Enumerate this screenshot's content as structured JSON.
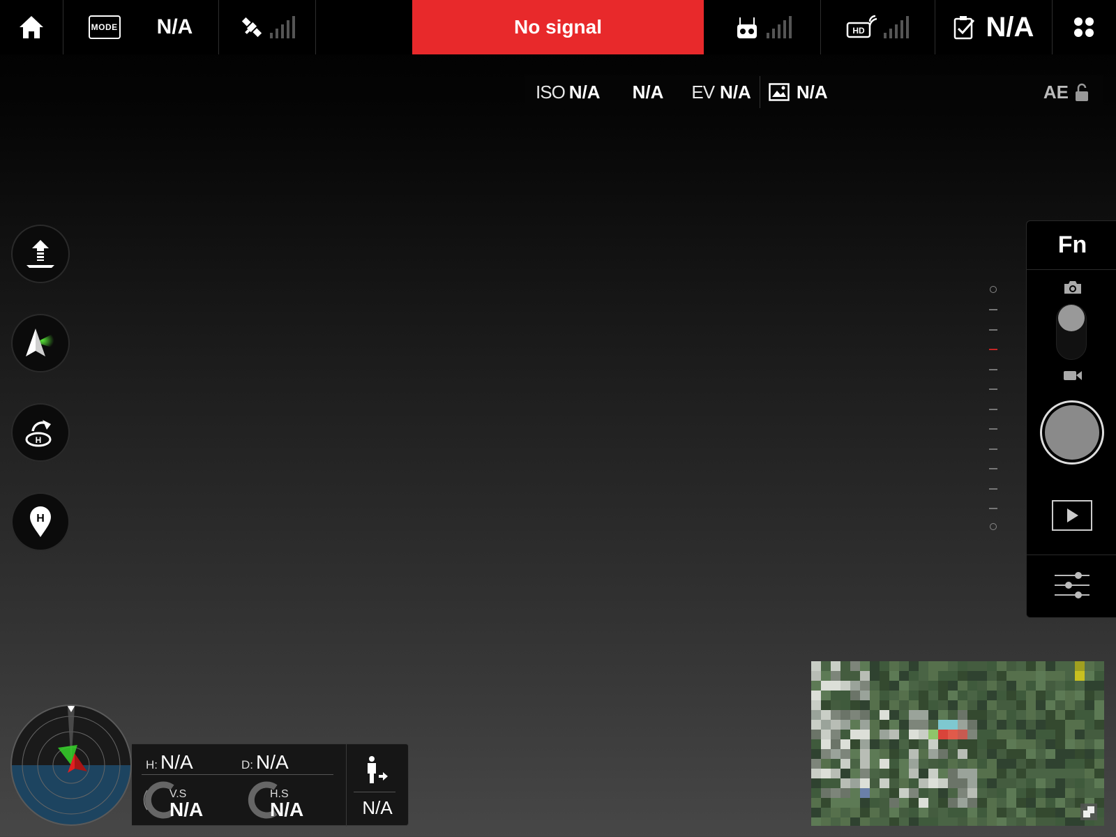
{
  "topbar": {
    "mode_label": "MODE",
    "flight_mode": "N/A",
    "status_banner": "No signal",
    "battery_value": "N/A"
  },
  "camera": {
    "iso_label": "ISO",
    "iso_value": "N/A",
    "shutter_value": "N/A",
    "ev_label": "EV",
    "ev_value": "N/A",
    "format_value": "N/A",
    "ae_label": "AE"
  },
  "right_panel": {
    "fn_label": "Fn"
  },
  "telemetry": {
    "height_label": "H:",
    "height_value": "N/A",
    "distance_label": "D:",
    "distance_value": "N/A",
    "vs_label": "V.S",
    "vs_value": "N/A",
    "hs_label": "H.S",
    "hs_value": "N/A",
    "vps_value": "N/A"
  },
  "colors": {
    "banner_red": "#e8292b",
    "radar_water": "#1d4460",
    "aircraft_red": "#e02020",
    "heading_green": "#36d42a"
  }
}
